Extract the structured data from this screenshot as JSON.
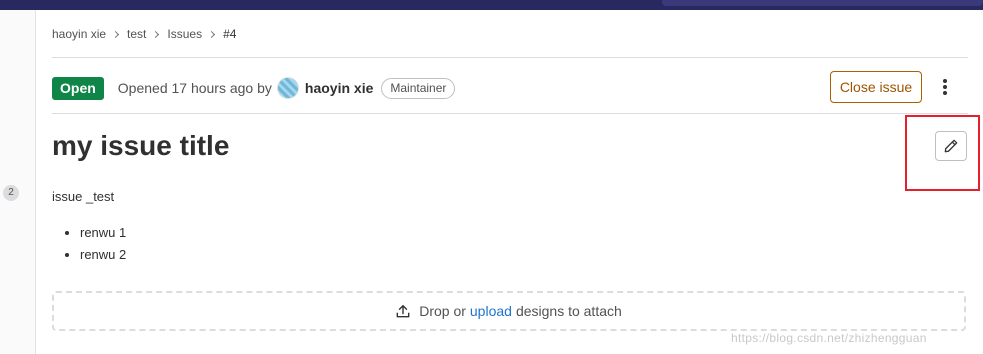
{
  "breadcrumb": {
    "items": [
      "haoyin xie",
      "test",
      "Issues"
    ],
    "current": "#4"
  },
  "issue": {
    "status": "Open",
    "opened_text": "Opened 17 hours ago by",
    "author": "haoyin xie",
    "role": "Maintainer",
    "title": "my issue title",
    "description": "issue _test",
    "list_items": [
      "renwu 1",
      "renwu 2"
    ]
  },
  "actions": {
    "close_label": "Close issue"
  },
  "sidebar": {
    "badge_count": "2"
  },
  "dropzone": {
    "prefix": "Drop or",
    "link": "upload",
    "suffix": "designs to attach"
  },
  "watermark": "https://blog.csdn.net/zhizhengguan",
  "colors": {
    "status_open": "#108548",
    "close_button": "#ab6100",
    "link": "#1f75cb",
    "highlight": "#e5202d"
  }
}
